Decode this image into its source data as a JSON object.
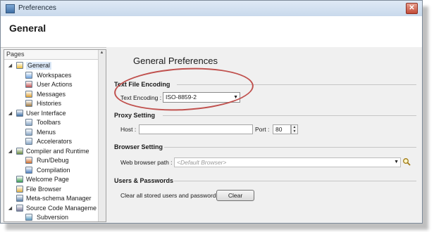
{
  "window": {
    "title": "Preferences"
  },
  "header": {
    "title": "General"
  },
  "pages": {
    "header": "Pages",
    "items": [
      {
        "label": "General",
        "indent": 0,
        "expand": "◢",
        "icon": "folder-icon"
      },
      {
        "label": "Workspaces",
        "indent": 1,
        "icon": "workspaces-icon"
      },
      {
        "label": "User Actions",
        "indent": 1,
        "icon": "user-actions-icon"
      },
      {
        "label": "Messages",
        "indent": 1,
        "icon": "messages-icon"
      },
      {
        "label": "Histories",
        "indent": 1,
        "icon": "histories-icon"
      },
      {
        "label": "User Interface",
        "indent": 0,
        "expand": "◢",
        "icon": "user-interface-icon"
      },
      {
        "label": "Toolbars",
        "indent": 1,
        "icon": "toolbars-icon"
      },
      {
        "label": "Menus",
        "indent": 1,
        "icon": "menus-icon"
      },
      {
        "label": "Accelerators",
        "indent": 1,
        "icon": "accelerators-icon"
      },
      {
        "label": "Compiler and Runtime",
        "indent": 0,
        "expand": "◢",
        "icon": "compiler-icon"
      },
      {
        "label": "Run/Debug",
        "indent": 1,
        "icon": "run-debug-icon"
      },
      {
        "label": "Compilation",
        "indent": 1,
        "icon": "compilation-icon"
      },
      {
        "label": "Welcome Page",
        "indent": 0,
        "icon": "welcome-icon"
      },
      {
        "label": "File Browser",
        "indent": 0,
        "icon": "file-browser-icon"
      },
      {
        "label": "Meta-schema Manager",
        "indent": 0,
        "icon": "meta-schema-icon"
      },
      {
        "label": "Source Code Manageme",
        "indent": 0,
        "expand": "◢",
        "icon": "source-code-icon"
      },
      {
        "label": "Subversion",
        "indent": 1,
        "icon": "subversion-icon"
      }
    ]
  },
  "main": {
    "title": "General Preferences",
    "encoding": {
      "section": "Text File Encoding",
      "label": "Text Encoding :",
      "value": "ISO-8859-2"
    },
    "proxy": {
      "section": "Proxy Setting",
      "host_label": "Host :",
      "host_value": "",
      "port_label": "Port :",
      "port_value": "80"
    },
    "browser": {
      "section": "Browser Setting",
      "path_label": "Web browser path :",
      "path_placeholder": "<Default Browser>"
    },
    "users": {
      "section": "Users & Passwords",
      "clear_label": "Clear all stored users and passwords",
      "clear_button": "Clear"
    }
  },
  "colors": {
    "highlight_ellipse": "#c0504d",
    "selection": "#dbe8f7"
  }
}
